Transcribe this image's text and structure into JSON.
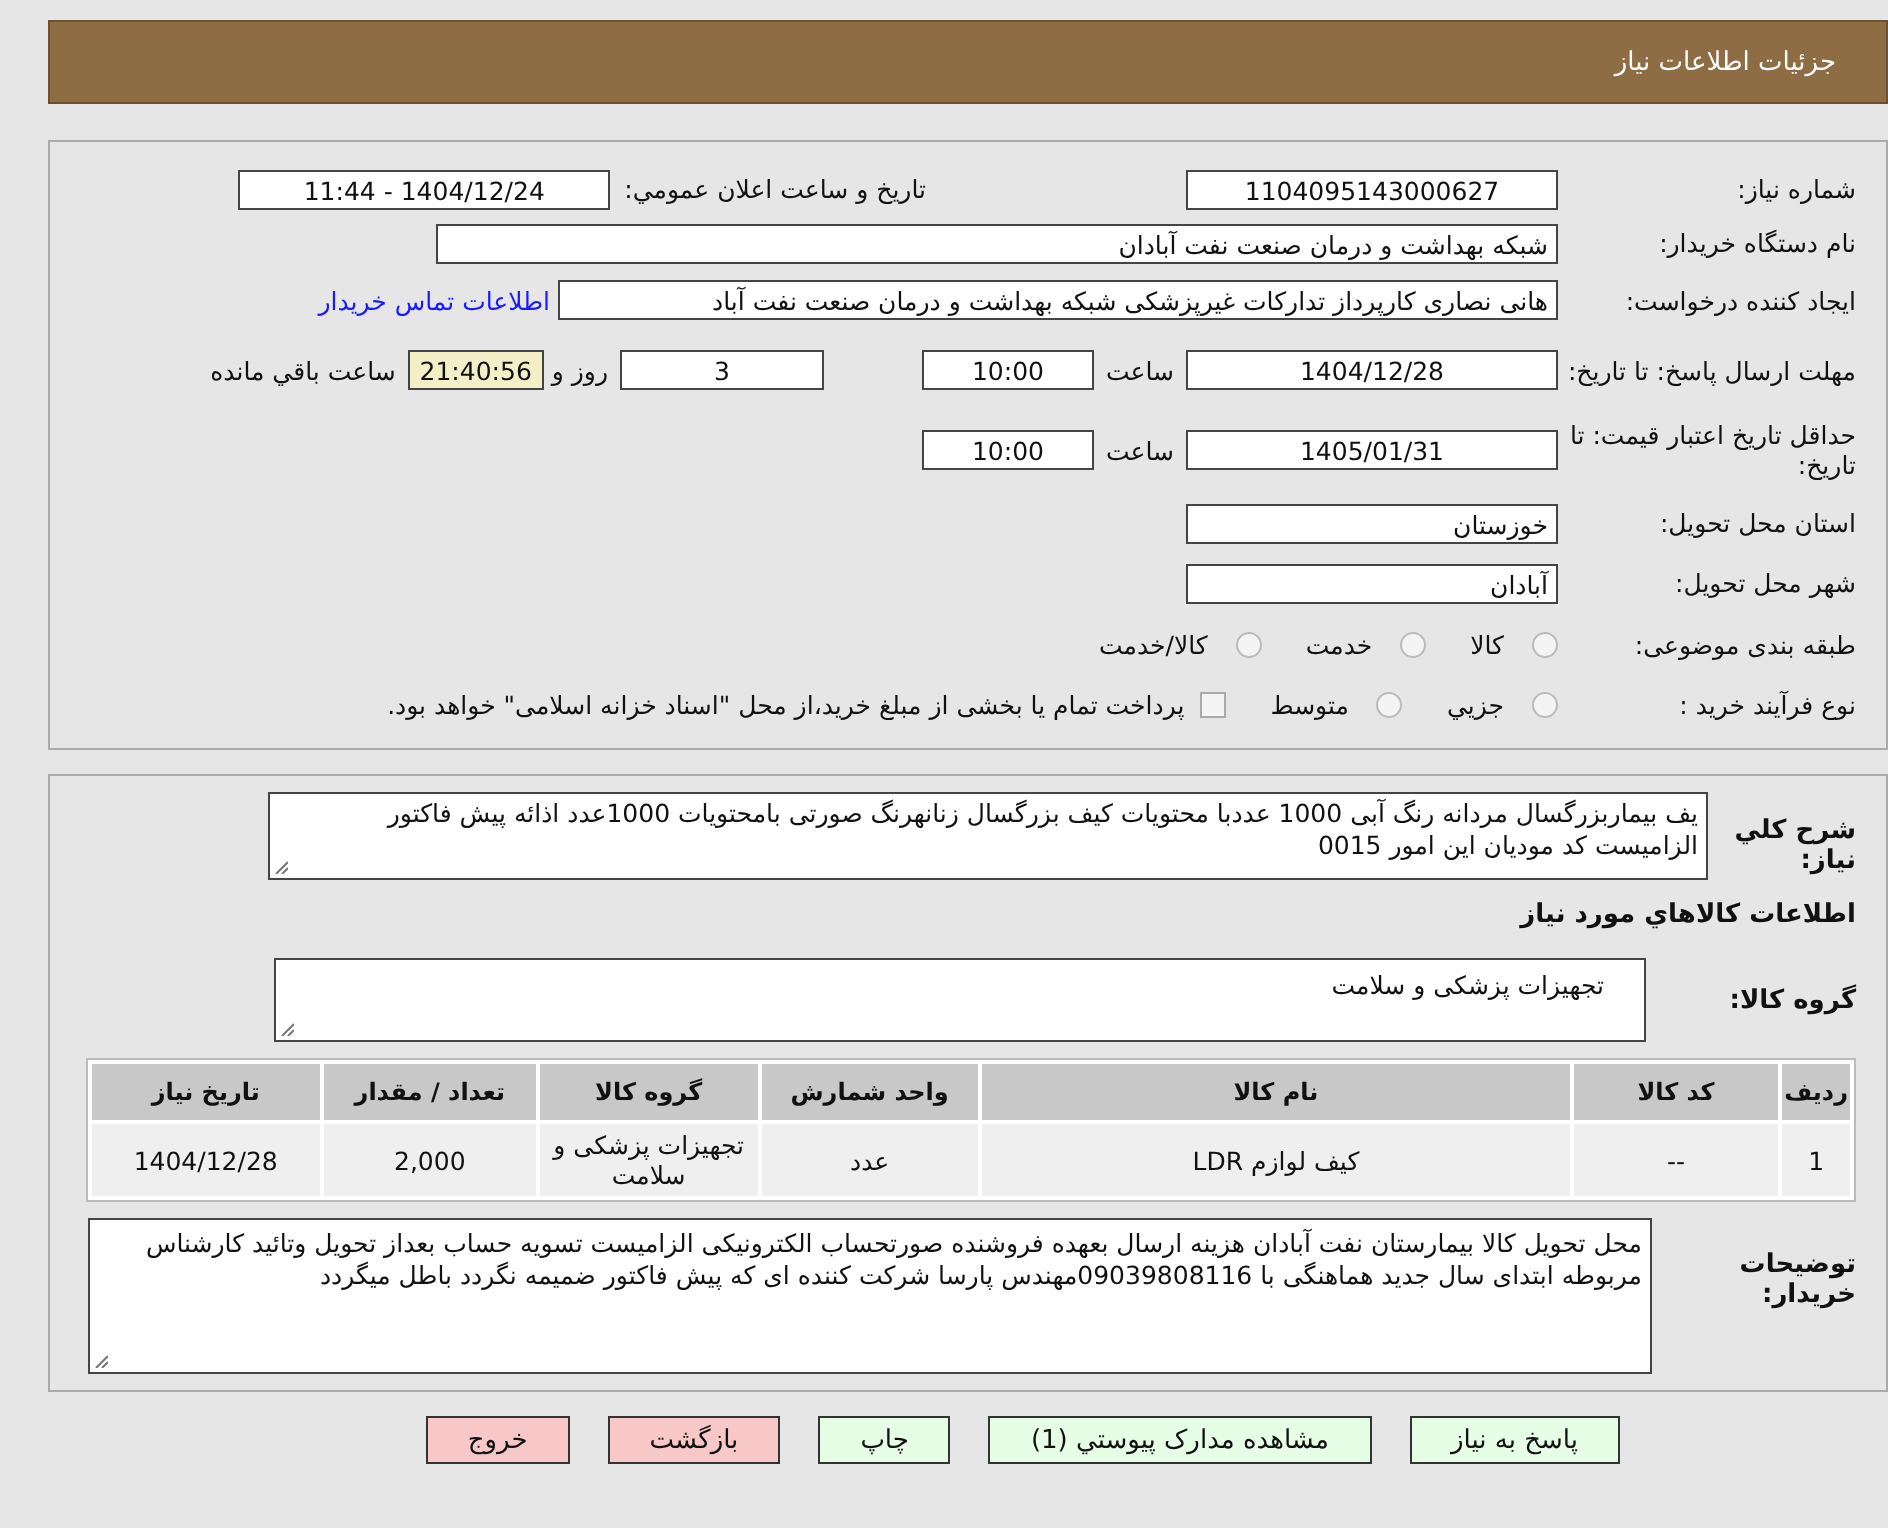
{
  "header": {
    "title": "جزئیات اطلاعات نیاز"
  },
  "need_number": {
    "label": "شماره نیاز:",
    "value": "1104095143000627",
    "announce_label": "تاریخ و ساعت اعلان عمومي:",
    "announce_value": "1404/12/24 - 11:44"
  },
  "buyer_org": {
    "label": "نام دستگاه خریدار:",
    "value": "شبکه بهداشت و درمان صنعت نفت آبادان"
  },
  "requester": {
    "label": "ایجاد کننده درخواست:",
    "value": "هانی نصاری کارپرداز تدارکات غیرپزشکی شبکه بهداشت و درمان صنعت نفت آباد",
    "link": "اطلاعات تماس خریدار"
  },
  "deadline": {
    "label": "مهلت ارسال پاسخ: تا تاریخ:",
    "date": "1404/12/28",
    "time_label": "ساعت",
    "time": "10:00",
    "days": "3",
    "days_label": "روز و",
    "remaining": "21:40:56",
    "remaining_label": "ساعت باقي مانده"
  },
  "validity": {
    "label": "حداقل تاریخ اعتبار قیمت: تا تاریخ:",
    "date": "1405/01/31",
    "time_label": "ساعت",
    "time": "10:00"
  },
  "province": {
    "label": "استان محل تحویل:",
    "value": "خوزستان"
  },
  "city": {
    "label": "شهر محل تحویل:",
    "value": "آبادان"
  },
  "category": {
    "label": "طبقه بندی موضوعی:",
    "options": [
      {
        "label": "کالا",
        "selected": false
      },
      {
        "label": "خدمت",
        "selected": false
      },
      {
        "label": "کالا/خدمت",
        "selected": false
      }
    ]
  },
  "process": {
    "label": "نوع فرآیند خرید :",
    "options": [
      {
        "label": "جزیي",
        "selected": false
      },
      {
        "label": "متوسط",
        "selected": false
      }
    ],
    "checkbox": {
      "label": "پرداخت تمام یا بخشی از مبلغ خرید،از محل \"اسناد خزانه اسلامی\" خواهد بود.",
      "checked": false
    }
  },
  "description": {
    "label": "شرح كلي نياز:",
    "value": "یف بیماربزرگسال مردانه رنگ آبی 1000 عددبا محتویات کیف بزرگسال زنانهرنگ صورتی بامحتویات 1000عدد اذائه پیش فاکتور الزامیست کد مودیان این امور 0015"
  },
  "goods_title": "اطلاعات كالاهاي مورد نياز",
  "goods_group": {
    "label": "گروه کالا:",
    "value": "تجهیزات پزشکی و سلامت"
  },
  "table": {
    "columns": [
      "ردیف",
      "کد کالا",
      "نام کالا",
      "واحد شمارش",
      "گروه کالا",
      "تعداد / مقدار",
      "تاریخ نیاز"
    ],
    "rows": [
      [
        "1",
        "--",
        "کیف لوازم LDR",
        "عدد",
        "تجهیزات پزشکی و سلامت",
        "2,000",
        "1404/12/28"
      ]
    ]
  },
  "buyer_notes": {
    "label": "توضیحات خریدار:",
    "value": "محل تحویل کالا بیمارستان نفت آبادان هزینه ارسال بعهده فروشنده صورتحساب الکترونیکی الزامیست تسویه حساب بعداز تحویل وتائید کارشناس مربوطه ابتدای سال جدید هماهنگی با 09039808116مهندس پارسا شرکت کننده ای که پیش فاکتور ضمیمه نگردد باطل میگردد"
  },
  "buttons": [
    {
      "label": "پاسخ به نیاز",
      "kind": "primary"
    },
    {
      "label": "مشاهده مدارک پیوستي (1)",
      "kind": "primary"
    },
    {
      "label": "چاپ",
      "kind": "primary"
    },
    {
      "label": "بازگشت",
      "kind": "danger"
    },
    {
      "label": "خروج",
      "kind": "danger"
    }
  ]
}
